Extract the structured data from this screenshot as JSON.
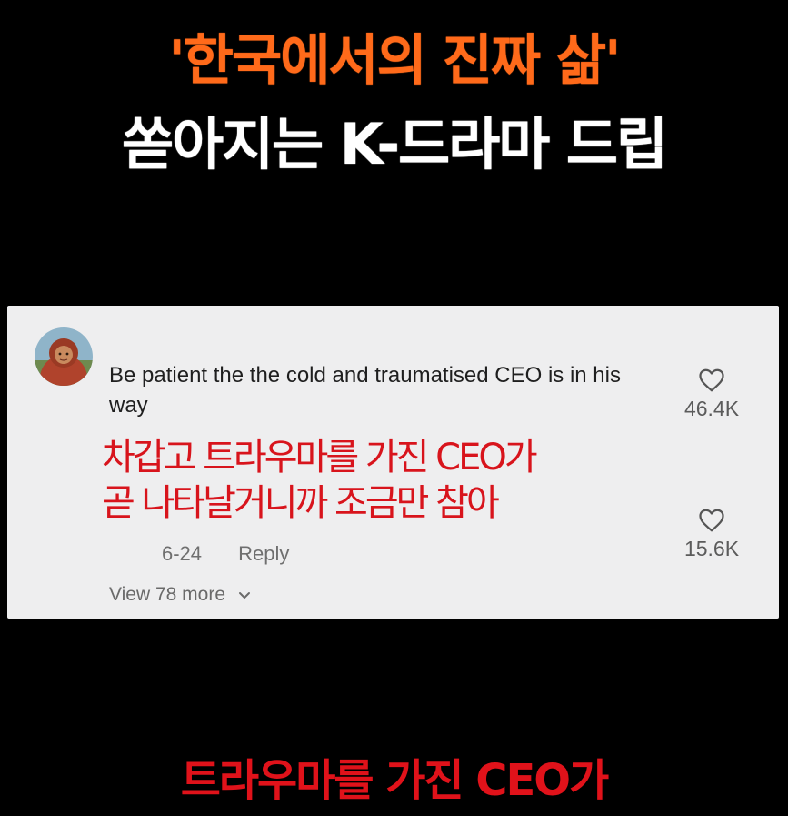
{
  "headline": {
    "line1": "'한국에서의 진짜 삶'",
    "line2": "쏟아지는 K-드라마 드립"
  },
  "comment": {
    "avatar_icon": "user-avatar-icon",
    "text": "Be patient the the cold and traumatised CEO is in his way",
    "like_count": "46.4K",
    "like_icon": "heart-icon"
  },
  "translation": {
    "line1": "차갑고 트라우마를 가진 CEO가",
    "line2": "곧 나타날거니까 조금만 참아"
  },
  "meta": {
    "date": "6-24",
    "reply_label": "Reply",
    "like_count": "15.6K"
  },
  "view_more": {
    "label": "View 78 more",
    "icon": "chevron-down-icon"
  },
  "bottom_caption": "트라우마를 가진 CEO가",
  "colors": {
    "headline_orange": "#ff6a1a",
    "subtitle_red": "#d8141c",
    "card_bg": "#eeeeef",
    "background": "#000000"
  }
}
